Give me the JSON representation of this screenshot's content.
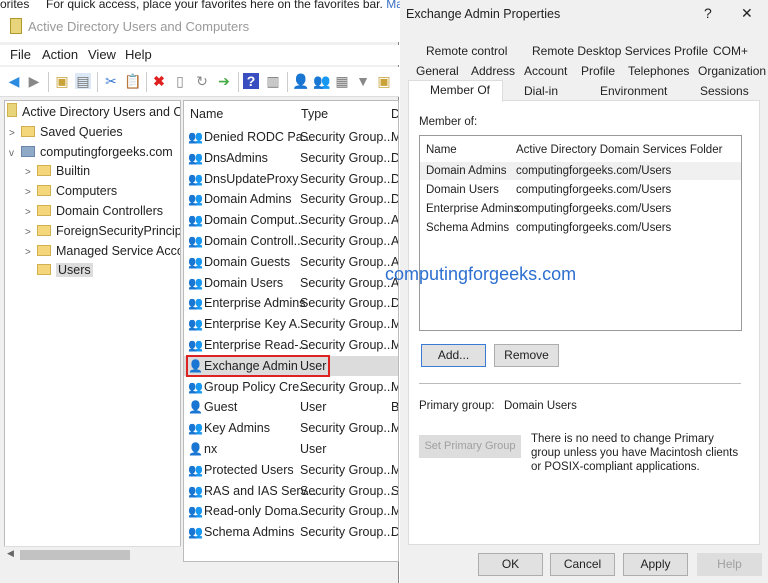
{
  "favorites_bar": {
    "prefix": "orites",
    "text": "For quick access, place your favorites here on the favorites bar.",
    "link": "Manage"
  },
  "aduc": {
    "title": "Active Directory Users and Computers",
    "menu": [
      "File",
      "Action",
      "View",
      "Help"
    ],
    "tree": {
      "root": "Active Directory Users and Com",
      "saved_queries": "Saved Queries",
      "domain": "computingforgeeks.com",
      "children": [
        "Builtin",
        "Computers",
        "Domain Controllers",
        "ForeignSecurityPrincipals",
        "Managed Service Accoun",
        "Users"
      ]
    },
    "list": {
      "headers": [
        "Name",
        "Type",
        "D"
      ],
      "rows": [
        {
          "name": "Denied RODC Pa...",
          "type": "Security Group...",
          "desc": "M",
          "icon": "group"
        },
        {
          "name": "DnsAdmins",
          "type": "Security Group...",
          "desc": "D",
          "icon": "group"
        },
        {
          "name": "DnsUpdateProxy",
          "type": "Security Group...",
          "desc": "D",
          "icon": "group"
        },
        {
          "name": "Domain Admins",
          "type": "Security Group...",
          "desc": "D",
          "icon": "group"
        },
        {
          "name": "Domain Comput...",
          "type": "Security Group...",
          "desc": "A",
          "icon": "group"
        },
        {
          "name": "Domain Controll...",
          "type": "Security Group...",
          "desc": "A",
          "icon": "group"
        },
        {
          "name": "Domain Guests",
          "type": "Security Group...",
          "desc": "A",
          "icon": "group"
        },
        {
          "name": "Domain Users",
          "type": "Security Group...",
          "desc": "A",
          "icon": "group"
        },
        {
          "name": "Enterprise Admins",
          "type": "Security Group...",
          "desc": "D",
          "icon": "group"
        },
        {
          "name": "Enterprise Key A...",
          "type": "Security Group...",
          "desc": "M",
          "icon": "group"
        },
        {
          "name": "Enterprise Read-...",
          "type": "Security Group...",
          "desc": "M",
          "icon": "group"
        },
        {
          "name": "Exchange Admin",
          "type": "User",
          "desc": "",
          "icon": "user",
          "selected": true
        },
        {
          "name": "Group Policy Cre...",
          "type": "Security Group...",
          "desc": "M",
          "icon": "group"
        },
        {
          "name": "Guest",
          "type": "User",
          "desc": "B",
          "icon": "user-disabled"
        },
        {
          "name": "Key Admins",
          "type": "Security Group...",
          "desc": "M",
          "icon": "group"
        },
        {
          "name": "nx",
          "type": "User",
          "desc": "",
          "icon": "user"
        },
        {
          "name": "Protected Users",
          "type": "Security Group...",
          "desc": "M",
          "icon": "group"
        },
        {
          "name": "RAS and IAS Serv...",
          "type": "Security Group...",
          "desc": "S",
          "icon": "group"
        },
        {
          "name": "Read-only Doma...",
          "type": "Security Group...",
          "desc": "M",
          "icon": "group"
        },
        {
          "name": "Schema Admins",
          "type": "Security Group...",
          "desc": "D",
          "icon": "group"
        }
      ]
    }
  },
  "dialog": {
    "title": "Exchange Admin Properties",
    "help_glyph": "?",
    "close_glyph": "✕",
    "tabs_row1": [
      "Remote control",
      "Remote Desktop Services Profile",
      "COM+"
    ],
    "tabs_row2": [
      "General",
      "Address",
      "Account",
      "Profile",
      "Telephones",
      "Organization"
    ],
    "tabs_row3": [
      "Member Of",
      "Dial-in",
      "Environment",
      "Sessions"
    ],
    "active_tab": "Member Of",
    "member_of_label": "Member of:",
    "columns": [
      "Name",
      "Active Directory Domain Services Folder"
    ],
    "members": [
      {
        "name": "Domain Admins",
        "folder": "computingforgeeks.com/Users"
      },
      {
        "name": "Domain Users",
        "folder": "computingforgeeks.com/Users"
      },
      {
        "name": "Enterprise Admins",
        "folder": "computingforgeeks.com/Users"
      },
      {
        "name": "Schema Admins",
        "folder": "computingforgeeks.com/Users"
      }
    ],
    "add_label": "Add...",
    "remove_label": "Remove",
    "primary_group_label": "Primary group:",
    "primary_group_value": "Domain Users",
    "set_primary_label": "Set Primary Group",
    "note": "There is no need to change Primary group unless you have Macintosh clients or POSIX-compliant applications.",
    "ok": "OK",
    "cancel": "Cancel",
    "apply": "Apply",
    "help": "Help"
  },
  "watermark": "computingforgeeks.com"
}
